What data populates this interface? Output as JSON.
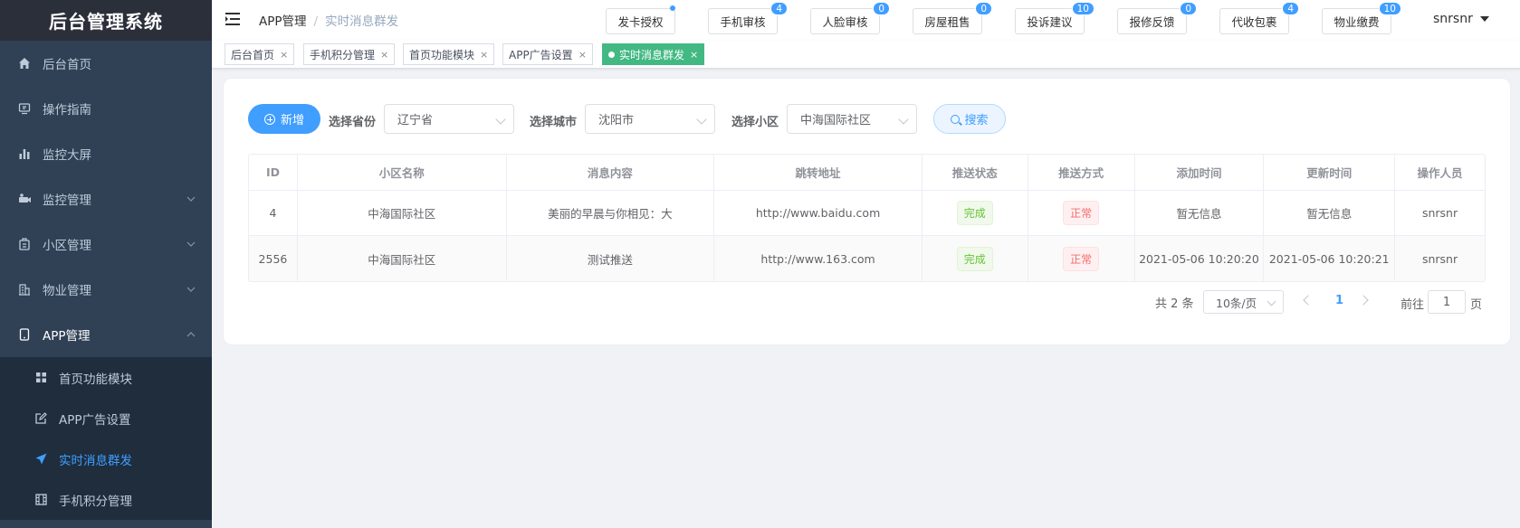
{
  "app": {
    "title": "后台管理系统"
  },
  "sidebar": {
    "items": [
      {
        "label": "后台首页",
        "icon": "home-icon"
      },
      {
        "label": "操作指南",
        "icon": "guide-icon"
      },
      {
        "label": "监控大屏",
        "icon": "chart-icon"
      },
      {
        "label": "监控管理",
        "icon": "camera-icon"
      },
      {
        "label": "小区管理",
        "icon": "building-icon"
      },
      {
        "label": "物业管理",
        "icon": "office-icon"
      },
      {
        "label": "APP管理",
        "icon": "tablet-icon"
      }
    ],
    "subitems": [
      {
        "label": "首页功能模块",
        "icon": "grid-icon"
      },
      {
        "label": "APP广告设置",
        "icon": "edit-icon"
      },
      {
        "label": "实时消息群发",
        "icon": "send-icon"
      },
      {
        "label": "手机积分管理",
        "icon": "film-icon"
      }
    ]
  },
  "navbar": {
    "breadcrumb": [
      "APP管理",
      "实时消息群发"
    ],
    "buttons": [
      {
        "label": "发卡授权",
        "badge": ""
      },
      {
        "label": "手机审核",
        "badge": "4"
      },
      {
        "label": "人脸审核",
        "badge": "0"
      },
      {
        "label": "房屋租售",
        "badge": "0"
      },
      {
        "label": "投诉建议",
        "badge": "10"
      },
      {
        "label": "报修反馈",
        "badge": "0"
      },
      {
        "label": "代收包裹",
        "badge": "4"
      },
      {
        "label": "物业缴费",
        "badge": "10"
      }
    ],
    "user": "snrsnr"
  },
  "tags": [
    {
      "label": "后台首页"
    },
    {
      "label": "手机积分管理"
    },
    {
      "label": "首页功能模块"
    },
    {
      "label": "APP广告设置"
    },
    {
      "label": "实时消息群发"
    }
  ],
  "filters": {
    "new_label": "新增",
    "province_label": "选择省份",
    "province_value": "辽宁省",
    "city_label": "选择城市",
    "city_value": "沈阳市",
    "community_label": "选择小区",
    "community_value": "中海国际社区",
    "search_label": "搜索"
  },
  "table": {
    "columns": [
      "ID",
      "小区名称",
      "消息内容",
      "跳转地址",
      "推送状态",
      "推送方式",
      "添加时间",
      "更新时间",
      "操作人员"
    ],
    "rows": [
      [
        "4",
        "中海国际社区",
        "美丽的早晨与你相见：大",
        "http://www.baidu.com",
        "完成",
        "正常",
        "暂无信息",
        "暂无信息",
        "snrsnr"
      ],
      [
        "2556",
        "中海国际社区",
        "测试推送",
        "http://www.163.com",
        "完成",
        "正常",
        "2021-05-06 10:20:20",
        "2021-05-06 10:20:21",
        "snrsnr"
      ]
    ]
  },
  "pagination": {
    "total": "共 2 条",
    "page_size": "10条/页",
    "current": "1",
    "goto_prefix": "前往",
    "goto_value": "1",
    "goto_suffix": "页"
  },
  "colors": {
    "primary": "#409eff",
    "sidebar": "#304156",
    "success": "#67c23a",
    "danger": "#f56c6c",
    "tag_active": "#42b983"
  }
}
